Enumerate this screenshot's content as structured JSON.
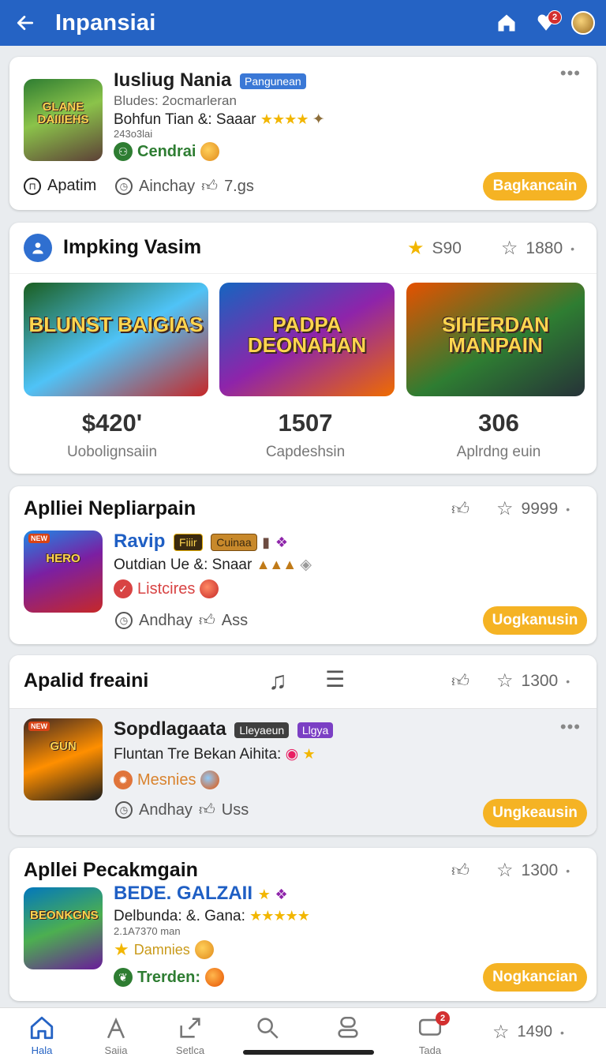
{
  "header": {
    "title": "Inpansiai",
    "notif_count": "2",
    "colors": {
      "bar": "#2563c4"
    },
    "icons": [
      "back-arrow-icon",
      "home-icon",
      "heart-icon",
      "avatar"
    ]
  },
  "card1": {
    "name": "Iusliug Nania",
    "tag": "Pangunean",
    "thumb_art": "GLANE DAIIIEHS",
    "line1": "Bludes: 2ocmarleran",
    "line2": "Bohfun Tian &: Saaar",
    "line3": "243o3lai",
    "badge": "Cendrai",
    "meta1": "Apatim",
    "meta2": "Ainchay",
    "meta3": "7.gs",
    "cta": "Bagkancain"
  },
  "featured": {
    "title": "Impking Vasim",
    "stat1": "S90",
    "stat2": "1880",
    "tiles": [
      {
        "art": "BLUNST BAIGIAS",
        "value": "$420'",
        "label": "Uobolignsaiin"
      },
      {
        "art": "PADPA DEONAHAN",
        "value": "1507",
        "label": "Capdeshsin"
      },
      {
        "art": "SIHERDAN MANPAIN",
        "value": "306",
        "label": "Aplrdng euin"
      }
    ]
  },
  "card3": {
    "title": "Aplliei Nepliarpain",
    "rating": "9999",
    "name": "Ravip",
    "tag1": "Fiiir",
    "tag2": "Cuinaa",
    "thumb_badge": "NEW",
    "thumb_art": "HERO",
    "line": "Outdian Ue &: Snaar",
    "badge": "Listcires",
    "meta1": "Andhay",
    "meta2": "Ass",
    "cta": "Uogkanusin"
  },
  "card4": {
    "title": "Apalid freaini",
    "rating": "1300",
    "name": "Sopdlagaata",
    "tag1": "Lleyaeun",
    "tag2": "Llgya",
    "thumb_badge": "NEW",
    "thumb_art": "GUN",
    "line": "Fluntan Tre Bekan Aihita:",
    "badge": "Mesnies",
    "meta1": "Andhay",
    "meta2": "Uss",
    "cta": "Ungkeausin"
  },
  "card5": {
    "title": "Apllei Pecakmgain",
    "rating": "1300",
    "name": "BEDE. GALZAII",
    "thumb_art": "BEONKGNS",
    "line1": "Delbunda: &. Gana:",
    "line2": "2.1A7370 man",
    "badge1": "Damnies",
    "badge2": "Trerden:",
    "cta": "Nogkancian"
  },
  "nav": {
    "items": [
      {
        "label": "Hala",
        "icon": "home-icon"
      },
      {
        "label": "Saiia",
        "icon": "tools-icon"
      },
      {
        "label": "Setlca",
        "icon": "share-icon"
      },
      {
        "label": "",
        "icon": "search-icon"
      },
      {
        "label": "",
        "icon": "profile-icon"
      },
      {
        "label": "Tada",
        "icon": "chat-icon"
      }
    ],
    "badge": "2",
    "rating": "1490"
  }
}
